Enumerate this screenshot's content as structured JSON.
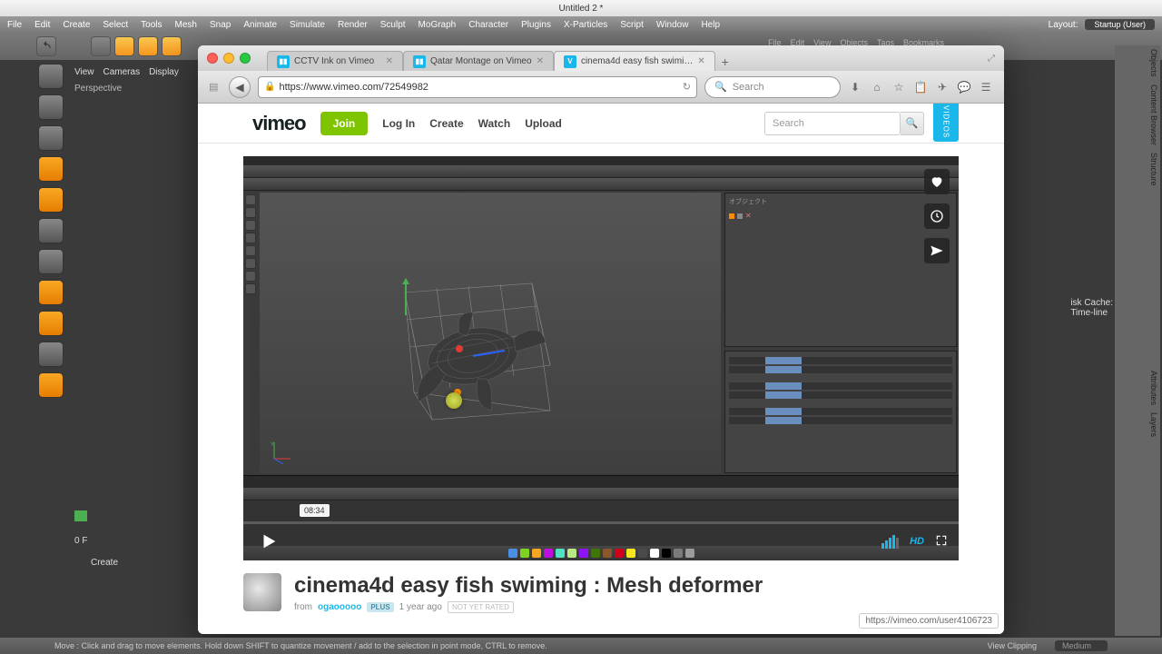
{
  "mac": {
    "title": "Untitled 2 *"
  },
  "c4d_menu": [
    "File",
    "Edit",
    "Create",
    "Select",
    "Tools",
    "Mesh",
    "Snap",
    "Animate",
    "Simulate",
    "Render",
    "Sculpt",
    "MoGraph",
    "Character",
    "Plugins",
    "X-Particles",
    "Script",
    "Window",
    "Help"
  ],
  "c4d_right": {
    "label": "Layout:",
    "value": "Startup (User)"
  },
  "obj_menu": [
    "File",
    "Edit",
    "View",
    "Objects",
    "Tags",
    "Bookmarks"
  ],
  "tabs": [
    {
      "label": "CCTV Ink on Vimeo",
      "active": false
    },
    {
      "label": "Qatar Montage on Vimeo",
      "active": false
    },
    {
      "label": "cinema4d easy fish swimi…",
      "active": true
    }
  ],
  "url": "https://www.vimeo.com/72549982",
  "search_placeholder": "Search",
  "vimeo": {
    "join": "Join",
    "nav": [
      "Log In",
      "Create",
      "Watch",
      "Upload"
    ],
    "search_placeholder": "Search",
    "videos_tab": "VIDEOS"
  },
  "player": {
    "time": "08:34",
    "hd": "HD"
  },
  "video": {
    "title": "cinema4d easy fish swiming : Mesh deformer",
    "from": "from",
    "author": "ogaooooo",
    "plus": "PLUS",
    "age": "1 year ago",
    "rating": "NOT YET RATED"
  },
  "hover_url": "https://vimeo.com/user4106723",
  "right_side_tabs": [
    "Objects",
    "Content Browser",
    "Structure",
    "Attributes",
    "Layers"
  ],
  "disk_cache": {
    "l1": "isk Cache:",
    "l2": "Time-line"
  },
  "viewport_info": {
    "view": "View",
    "cameras": "Cameras",
    "display": "Display",
    "persp": "Perspective"
  },
  "status": {
    "hint": "Move : Click and drag to move elements. Hold down SHIFT to quantize movement / add to the selection in point mode, CTRL to remove.",
    "clip": "View Clipping",
    "medium": "Medium",
    "frame": "0 F",
    "create": "Create"
  },
  "dock_colors": [
    "#4a90e2",
    "#7ed321",
    "#f5a623",
    "#bd10e0",
    "#50e3c2",
    "#b8e986",
    "#9013fe",
    "#417505",
    "#8b572a",
    "#d0021b",
    "#f8e71c",
    "#4a4a4a",
    "#ffffff",
    "#000000",
    "#7b7b7b",
    "#9b9b9b"
  ]
}
